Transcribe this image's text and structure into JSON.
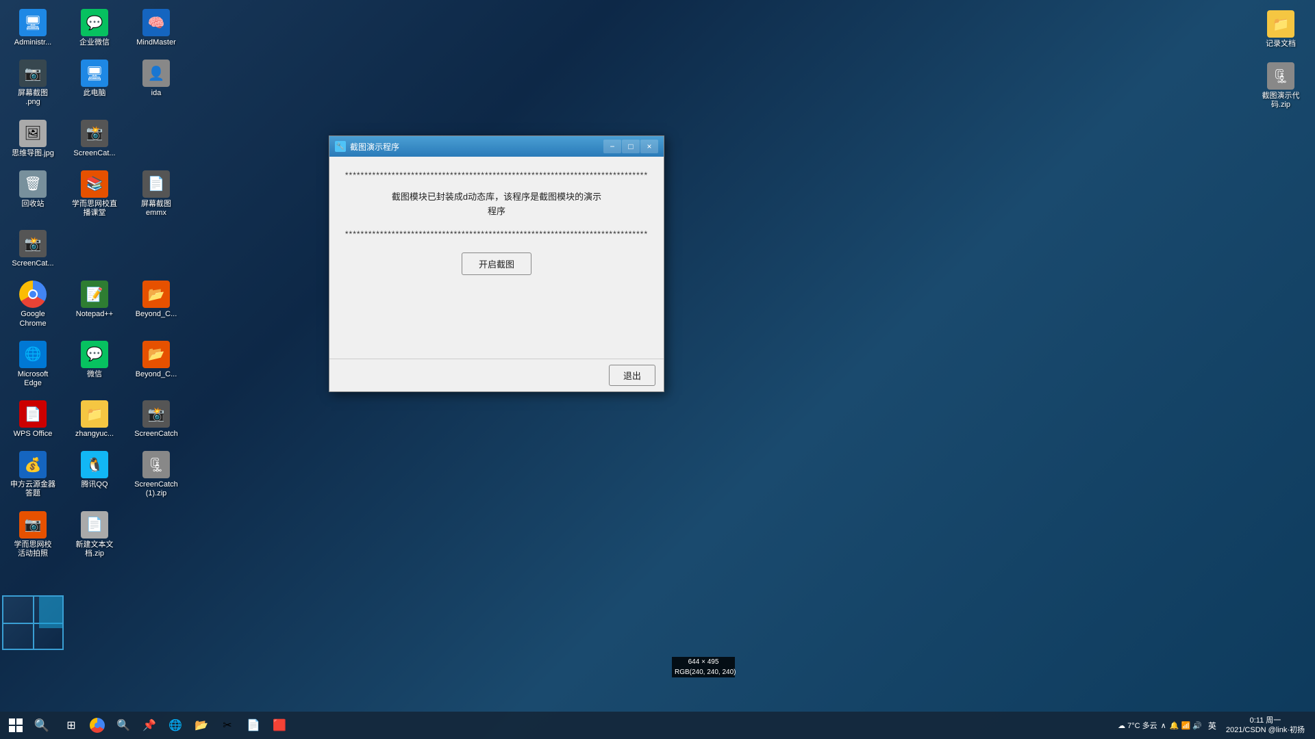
{
  "desktop": {
    "icons_left": [
      {
        "id": "administrator",
        "label": "Administr...",
        "emoji": "🖥️",
        "color": "#1e88e5"
      },
      {
        "id": "qiyeweixin",
        "label": "企业微信",
        "emoji": "🟢",
        "color": "#07c160"
      },
      {
        "id": "mindmaster",
        "label": "MindMaster",
        "emoji": "🟦",
        "color": "#1565c0"
      },
      {
        "id": "screenshot-png",
        "label": "屏幕截图.png",
        "emoji": "📷",
        "color": "#555"
      },
      {
        "id": "this-pc",
        "label": "此电脑",
        "emoji": "🖥",
        "color": "#1e88e5"
      },
      {
        "id": "ida",
        "label": "ida",
        "emoji": "👤",
        "color": "#888"
      },
      {
        "id": "sixiang-jpg",
        "label": "思维导图.jpg",
        "emoji": "🖼",
        "color": "#aaa"
      },
      {
        "id": "screencatch",
        "label": "ScreenCat...",
        "emoji": "📸",
        "color": "#555"
      },
      {
        "id": "huishou",
        "label": "回收站",
        "emoji": "🗑",
        "color": "#78909c"
      },
      {
        "id": "xueshenyixiao",
        "label": "学而思网校直播课堂",
        "emoji": "📚",
        "color": "#e65100"
      },
      {
        "id": "pingmu-emmx",
        "label": "屏幕截图emmx",
        "emoji": "📄",
        "color": "#555"
      },
      {
        "id": "screencatch2",
        "label": "ScreenCat...",
        "emoji": "📸",
        "color": "#555"
      },
      {
        "id": "google-chrome",
        "label": "Google Chrome",
        "emoji": "🌐",
        "color": "#4285f4"
      },
      {
        "id": "notepadpp",
        "label": "Notepad++",
        "emoji": "📝",
        "color": "#2e7d32"
      },
      {
        "id": "beyond-compare",
        "label": "Beyond_C...",
        "emoji": "📂",
        "color": "#e65100"
      },
      {
        "id": "microsoft-edge",
        "label": "Microsoft Edge",
        "emoji": "🌐",
        "color": "#0078d4"
      },
      {
        "id": "weixin",
        "label": "微信",
        "emoji": "💬",
        "color": "#07c160"
      },
      {
        "id": "beyond-c2",
        "label": "Beyond_C...",
        "emoji": "📂",
        "color": "#e65100"
      },
      {
        "id": "wps-office",
        "label": "WPS Office",
        "emoji": "📄",
        "color": "#cc0000"
      },
      {
        "id": "zhangyuec",
        "label": "zhangyuc...",
        "emoji": "📁",
        "color": "#f5c642"
      },
      {
        "id": "screencatch3",
        "label": "ScreenCatch",
        "emoji": "📸",
        "color": "#555"
      },
      {
        "id": "ufida",
        "label": "申方云源金器答题",
        "emoji": "💰",
        "color": "#1565c0"
      },
      {
        "id": "qqtongxin",
        "label": "腾讯QQ",
        "emoji": "🐧",
        "color": "#12b7f5"
      },
      {
        "id": "screencatch-zip",
        "label": "ScreenCatch(1).zip",
        "emoji": "🗜",
        "color": "#888"
      },
      {
        "id": "xueshenyixiao2",
        "label": "学而思网校活动拍照",
        "emoji": "📷",
        "color": "#e65100"
      },
      {
        "id": "new-txt",
        "label": "新建文本文档.zip",
        "emoji": "📄",
        "color": "#aaa"
      }
    ],
    "icons_right": [
      {
        "id": "jilu-doc",
        "label": "记录文档",
        "emoji": "📁",
        "color": "#f5c642"
      },
      {
        "id": "jietushiyan",
        "label": "截图演示代码.zip",
        "emoji": "🗜",
        "color": "#888"
      }
    ]
  },
  "dialog": {
    "title": "截图演示程序",
    "icon": "📷",
    "stars_top": "******************************************************************************",
    "message_line1": "截图模块已封装成d动态库，该程序是截图模块的演示",
    "message_line2": "程序",
    "stars_bottom": "******************************************************************************",
    "start_button_label": "开启截图",
    "exit_button_label": "退出",
    "minimize_label": "−",
    "maximize_label": "□",
    "close_label": "×"
  },
  "preview": {
    "dimensions": "644 × 495",
    "rgb": "RGB(240, 240, 240)"
  },
  "taskbar": {
    "apps": [
      {
        "id": "file-explorer",
        "emoji": "📁"
      },
      {
        "id": "chrome",
        "emoji": "🌐"
      },
      {
        "id": "task3",
        "emoji": "🔍"
      },
      {
        "id": "task4",
        "emoji": "📌"
      },
      {
        "id": "task5",
        "emoji": "🔵"
      },
      {
        "id": "task6",
        "emoji": "📂"
      },
      {
        "id": "task7",
        "emoji": "✂️"
      },
      {
        "id": "task8",
        "emoji": "📄"
      },
      {
        "id": "task9",
        "emoji": "🟥"
      }
    ],
    "system": {
      "weather": "7°C 多云",
      "language": "英",
      "time": "0:11 周一",
      "date": "2021/CSDN @link·初扬"
    }
  }
}
